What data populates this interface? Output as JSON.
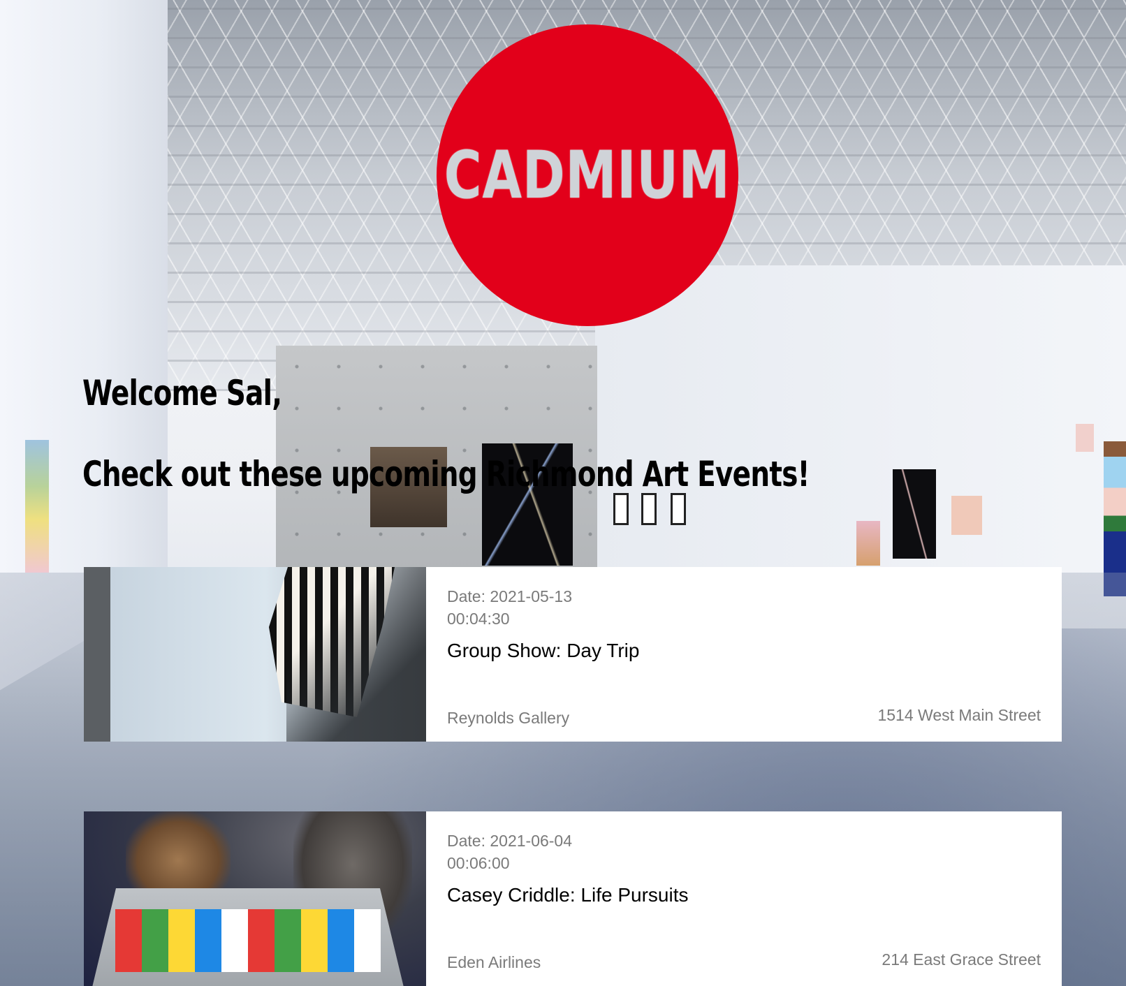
{
  "header": {
    "logo_text": "CADMIUM",
    "logo_color": "#e2001a"
  },
  "main": {
    "welcome": "Welcome Sal,",
    "subtitle": "Check out these upcoming Richmond Art Events!"
  },
  "events": [
    {
      "date_label": "Date: 2021-05-13",
      "time": "00:04:30",
      "title": "Group Show: Day Trip",
      "venue": "Reynolds Gallery",
      "address": "1514 West Main Street"
    },
    {
      "date_label": "Date: 2021-06-04",
      "time": "00:06:00",
      "title": "Casey Criddle: Life Pursuits",
      "venue": "Eden Airlines",
      "address": "214 East Grace Street"
    }
  ]
}
